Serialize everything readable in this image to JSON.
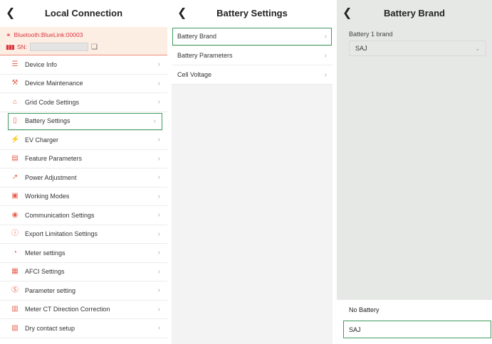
{
  "local_connection": {
    "title": "Local Connection",
    "bluetooth": "Bluetooth:BlueLink:00003",
    "sn_label": "SN:",
    "menu": [
      {
        "label": "Device Info",
        "icon": "document-list-icon"
      },
      {
        "label": "Device Maintenance",
        "icon": "wrench-icon"
      },
      {
        "label": "Grid Code Settings",
        "icon": "grid-tower-icon"
      },
      {
        "label": "Battery Settings",
        "icon": "battery-icon",
        "selected": true
      },
      {
        "label": "EV Charger",
        "icon": "ev-charger-icon"
      },
      {
        "label": "Feature Parameters",
        "icon": "toolbox-icon"
      },
      {
        "label": "Power Adjustment",
        "icon": "chart-icon"
      },
      {
        "label": "Working Modes",
        "icon": "mode-icon"
      },
      {
        "label": "Communication Settings",
        "icon": "antenna-icon"
      },
      {
        "label": "Export Limitation Settings",
        "icon": "export-icon"
      },
      {
        "label": "Meter settings",
        "icon": "meter-icon"
      },
      {
        "label": "AFCI Settings",
        "icon": "afci-icon"
      },
      {
        "label": "Parameter setting",
        "icon": "parameter-icon"
      },
      {
        "label": "Meter CT Direction Correction",
        "icon": "ct-icon"
      },
      {
        "label": "Dry contact setup",
        "icon": "dry-contact-icon"
      }
    ]
  },
  "battery_settings": {
    "title": "Battery Settings",
    "items": [
      {
        "label": "Battery Brand",
        "selected": true
      },
      {
        "label": "Battery Parameters"
      },
      {
        "label": "Cell Voltage"
      }
    ]
  },
  "battery_brand": {
    "title": "Battery Brand",
    "field_label": "Battery 1 brand",
    "selected_value": "SAJ",
    "options": [
      "No Battery",
      "SAJ"
    ]
  },
  "colors": {
    "accent_red": "#d9363e",
    "selection_green": "#3d9a5e"
  }
}
